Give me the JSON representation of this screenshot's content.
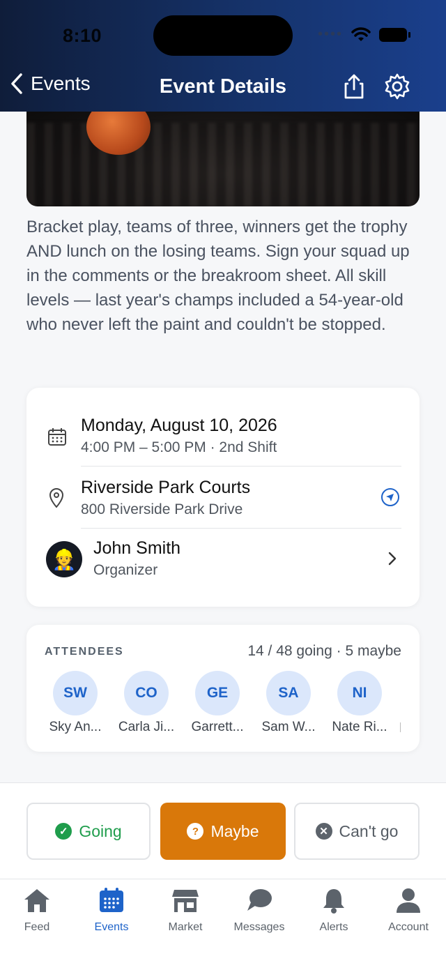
{
  "status_bar": {
    "time": "8:10"
  },
  "nav": {
    "back_label": "Events",
    "title": "Event Details"
  },
  "description": "Bracket play, teams of three, winners get the trophy AND lunch on the losing teams. Sign your squad up in the comments or the breakroom sheet. All skill levels — last year's champs included a 54-year-old who never left the paint and couldn't be stopped.",
  "details": {
    "date": "Monday, August 10, 2026",
    "time": "4:00 PM – 5:00 PM · 2nd Shift",
    "location_name": "Riverside Park Courts",
    "location_address": "800 Riverside Park Drive",
    "organizer_name": "John Smith",
    "organizer_role": "Organizer"
  },
  "attendees": {
    "label": "ATTENDEES",
    "count": "14 / 48 going · 5 maybe",
    "people": [
      {
        "initials": "SW",
        "name": "Sky An..."
      },
      {
        "initials": "CO",
        "name": "Carla Ji..."
      },
      {
        "initials": "GE",
        "name": "Garrett..."
      },
      {
        "initials": "SA",
        "name": "Sam W..."
      },
      {
        "initials": "NI",
        "name": "Nate Ri..."
      }
    ]
  },
  "rsvp": {
    "going": "Going",
    "maybe": "Maybe",
    "cant": "Can't go"
  },
  "tabs": [
    {
      "label": "Feed",
      "icon": "home-icon"
    },
    {
      "label": "Events",
      "icon": "calendar-icon"
    },
    {
      "label": "Market",
      "icon": "store-icon"
    },
    {
      "label": "Messages",
      "icon": "chat-bubble-icon"
    },
    {
      "label": "Alerts",
      "icon": "bell-icon"
    },
    {
      "label": "Account",
      "icon": "person-icon"
    }
  ],
  "colors": {
    "accent": "#1e63c9",
    "maybe": "#d9780a",
    "going": "#1f9d4c",
    "header": "#16346e"
  }
}
